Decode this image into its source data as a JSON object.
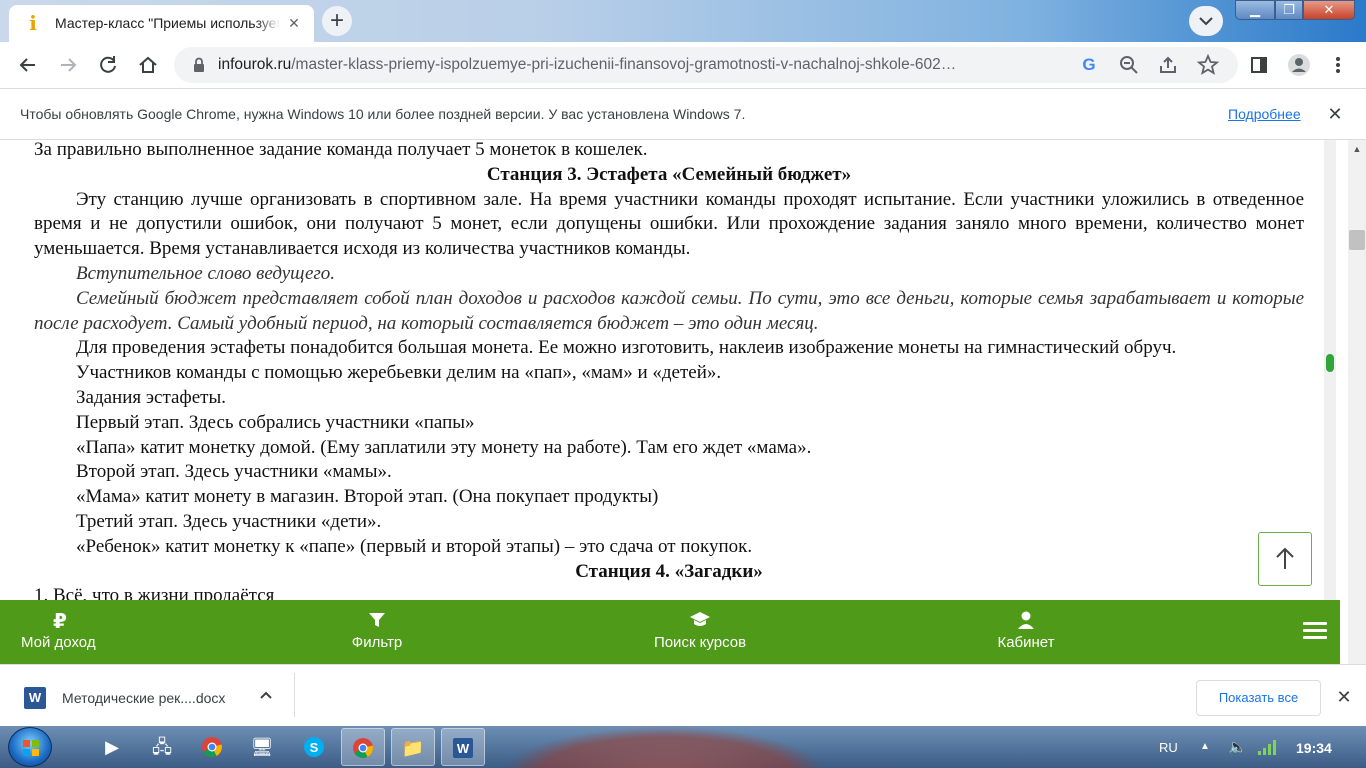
{
  "tab": {
    "title": "Мастер-класс \"Приемы используемые при изучении финансовой грамотности\"",
    "favicon": "i"
  },
  "toolbar": {
    "url_host": "infourok.ru",
    "url_path": "/master-klass-priemy-ispolzuemye-pri-izuchenii-finansovoj-gramotnosti-v-nachalnoj-shkole-602…"
  },
  "infobar": {
    "text": "Чтобы обновлять Google Chrome, нужна Windows 10 или более поздней версии. У вас установлена Windows 7.",
    "link": "Подробнее"
  },
  "document": {
    "lines": [
      "За правильно выполненное задание команда получает 5 монеток в кошелек.",
      "Станция 3. Эстафета «Семейный бюджет»",
      "Эту станцию лучше организовать в спортивном зале. На время участники команды проходят испытание. Если участники уложились в отведенное время и не допустили ошибок, они получают 5 монет, если допущены ошибки. Или прохождение задания заняло много времени, количество монет уменьшается. Время устанавливается исходя из количества участников команды.",
      "Вступительное слово ведущего.",
      "Семейный бюджет представляет собой план доходов и расходов каждой семьи. По сути, это все деньги, которые семья зарабатывает и которые после расходует. Самый удобный период, на который составляется бюджет – это один месяц.",
      "Для проведения эстафеты понадобится большая монета. Ее можно изготовить, наклеив изображение монеты на гимнастический обруч.",
      "Участников команды с помощью жеребьевки делим на «пап», «мам» и «детей».",
      "Задания эстафеты.",
      "Первый этап. Здесь собрались участники «папы»",
      "«Папа» катит монетку домой. (Ему заплатили эту монету  на работе). Там его ждет «мама».",
      "Второй этап. Здесь участники «мамы».",
      "«Мама» катит монету в магазин. Второй этап. (Она покупает продукты)",
      "Третий этап. Здесь участники «дети».",
      "«Ребенок» катит монетку к «папе» (первый и второй этапы) – это сдача от покупок.",
      "Станция 4. «Загадки»",
      "1. Всё, что в жизни продаётся"
    ]
  },
  "greenbar": {
    "items": [
      {
        "icon": "₽",
        "label": "Мой доход"
      },
      {
        "icon": "▼",
        "label": "Фильтр"
      },
      {
        "icon": "🎓",
        "label": "Поиск курсов"
      },
      {
        "icon": "👤",
        "label": "Кабинет"
      }
    ]
  },
  "downloads": {
    "file_name": "Методические рек....docx",
    "show_all": "Показать все",
    "icon_letter": "W"
  },
  "taskbar": {
    "lang": "RU",
    "time": "19:34"
  },
  "colors": {
    "green": "#4f9a19",
    "link": "#1a73e8"
  }
}
